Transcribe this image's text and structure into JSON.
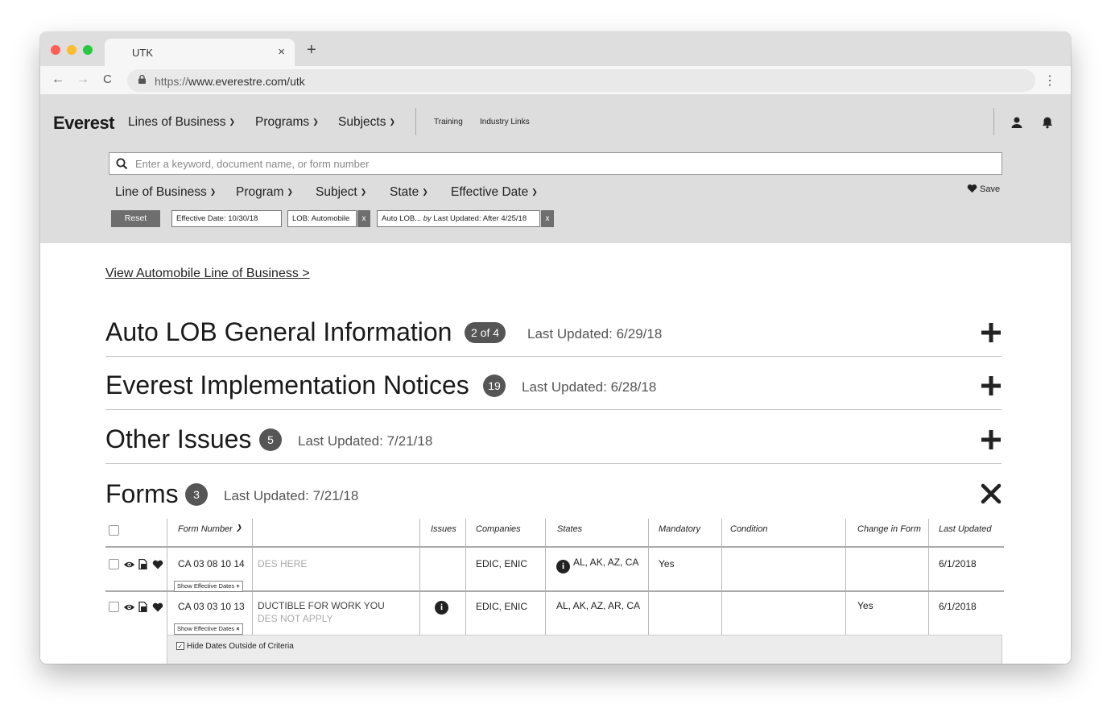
{
  "browser": {
    "tab_title": "UTK",
    "tab_close": "×",
    "new_tab": "+",
    "url_scheme": "https://",
    "url_rest": "www.everestre.com/utk",
    "back": "←",
    "forward": "→",
    "reload": "C",
    "menu": "⋮"
  },
  "header": {
    "logo": "Everest",
    "nav": [
      "Lines of Business",
      "Programs",
      "Subjects"
    ],
    "links": [
      "Training",
      "Industry Links"
    ],
    "search_placeholder": "Enter a keyword, document name, or form number",
    "filters": [
      "Line of Business",
      "Program",
      "Subject",
      "State",
      "Effective Date"
    ],
    "save_label": "Save",
    "reset_label": "Reset",
    "chips": [
      {
        "label": "Effective Date: 10/30/18"
      },
      {
        "label": "LOB: Automobile",
        "remove": "x"
      },
      {
        "label_prefix": "Auto LOB... ",
        "label_by": "by",
        "label_suffix": " Last Updated: After 4/25/18",
        "remove": "x"
      }
    ]
  },
  "main": {
    "view_link": "View Automobile Line of Business >",
    "sections": [
      {
        "title": "Auto LOB General Information",
        "badge": "2 of 4",
        "updated": "Last Updated: 6/29/18",
        "state": "collapsed"
      },
      {
        "title": "Everest Implementation Notices",
        "badge": "19",
        "updated": "Last Updated: 6/28/18",
        "state": "collapsed"
      },
      {
        "title": "Other Issues",
        "badge": "5",
        "updated": "Last Updated: 7/21/18",
        "state": "collapsed"
      },
      {
        "title": "Forms",
        "badge": "3",
        "updated": "Last Updated: 7/21/18",
        "state": "expanded"
      }
    ],
    "forms_table": {
      "columns": [
        "Form Number",
        "",
        "Issues",
        "Companies",
        "States",
        "Mandatory",
        "Condition",
        "Change in Form",
        "Last Updated"
      ],
      "rows": [
        {
          "form_number": "CA 03 08 10 14",
          "title_a": "DES HERE",
          "title_b": "",
          "issues_icon": false,
          "companies": "EDIC, ENIC",
          "states_info": true,
          "states": "AL, AK, AZ, CA",
          "mandatory": "Yes",
          "condition": "",
          "change": "",
          "last_updated": "6/1/2018",
          "eff_label": "Show Effective Dates",
          "eff_icon": "+"
        },
        {
          "form_number": "CA 03 03 10 13",
          "title_a": "DUCTIBLE FOR WORK YOU",
          "title_b": "DES NOT APPLY",
          "issues_icon": true,
          "companies": "EDIC, ENIC",
          "states_info": false,
          "states": "AL, AK, AZ, AR, CA",
          "mandatory": "",
          "condition": "",
          "change": "Yes",
          "last_updated": "6/1/2018",
          "eff_label": "Show Effective Dates",
          "eff_icon": "×"
        }
      ],
      "hide_dates_label": "Hide Dates Outside of Criteria",
      "hide_dates_checked": true
    }
  },
  "colors": {
    "header_bg": "#dddddd",
    "badge_bg": "#555555",
    "button_dark": "#6e6e6e"
  }
}
